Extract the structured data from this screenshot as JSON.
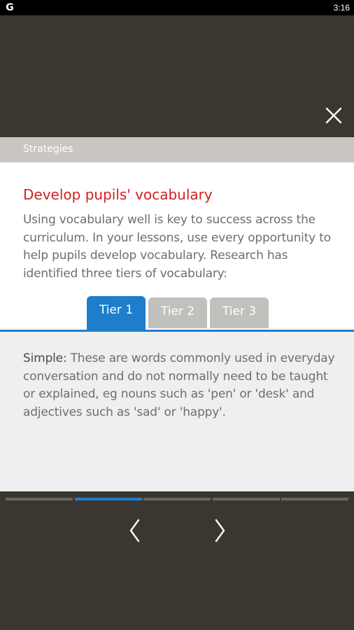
{
  "status_bar": {
    "app_letter": "G",
    "time": "3:16"
  },
  "section": {
    "label": "Strategies"
  },
  "content": {
    "heading": "Develop pupils' vocabulary",
    "intro": "Using vocabulary well is key to success across the curriculum. In your lessons, use every opportunity to help pupils develop vocabulary. Research has identified three tiers of vocabulary:",
    "tabs": [
      {
        "label": "Tier 1",
        "active": true
      },
      {
        "label": "Tier 2",
        "active": false
      },
      {
        "label": "Tier 3",
        "active": false
      }
    ],
    "panel": {
      "term": "Simple:",
      "text": " These are words commonly used in everyday conversation and do not normally need to be taught or explained, eg nouns such as 'pen' or 'desk' and adjectives such as 'sad' or 'happy'."
    }
  },
  "progress": {
    "segments": 5,
    "current": 2
  },
  "icons": {
    "close": "close-icon",
    "previous": "chevron-left-icon",
    "next": "chevron-right-icon"
  },
  "colors": {
    "background": "#3b3630",
    "heading": "#d3211f",
    "accent": "#1f7ecb",
    "tab_inactive": "#c2c0bd",
    "section_bar": "#c9c6c2",
    "panel_bg": "#efefef",
    "progress_inactive": "#6a655f"
  }
}
